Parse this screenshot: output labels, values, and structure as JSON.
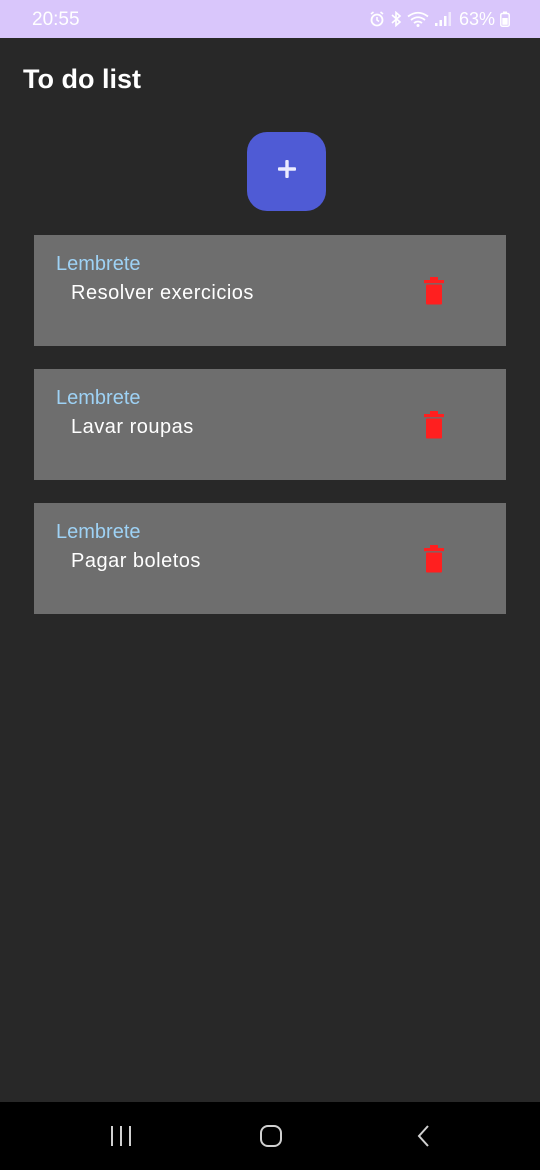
{
  "status_bar": {
    "time": "20:55",
    "battery_percent": "63%",
    "background_color": "#d9c6fb",
    "icons": [
      "alarm-icon",
      "bluetooth-icon",
      "wifi-icon",
      "signal-icon",
      "battery-icon"
    ]
  },
  "app": {
    "title": "To do list",
    "add_button_label": "+",
    "accent_color": "#4f5bd5",
    "delete_color": "#ff1f1f"
  },
  "tasks": [
    {
      "caption": "Lembrete",
      "text": "Resolver exercicios"
    },
    {
      "caption": "Lembrete",
      "text": "Lavar roupas"
    },
    {
      "caption": "Lembrete",
      "text": "Pagar boletos"
    }
  ],
  "nav_bar": {
    "buttons": [
      "recent-apps-icon",
      "home-icon",
      "back-icon"
    ]
  }
}
